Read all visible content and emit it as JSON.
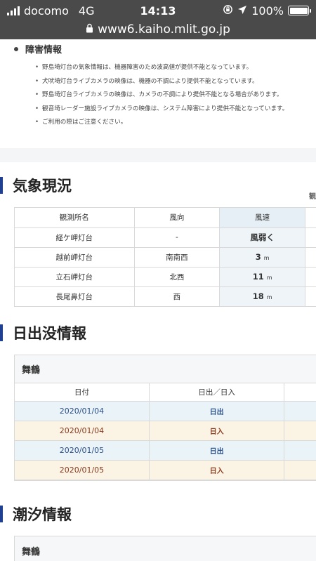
{
  "status_bar": {
    "carrier": "docomo",
    "network": "4G",
    "time": "14:13",
    "battery": "100%"
  },
  "url_bar": {
    "url": "www6.kaiho.mlit.go.jp"
  },
  "notice": {
    "title": "障害情報",
    "items": [
      "野島埼灯台の気象情報は、機器障害のため波高値が提供不能となっています。",
      "犬吠埼灯台ライブカメラの映像は、機器の不調により提供不能となっています。",
      "野島埼灯台ライブカメラの映像は、カメラの不調により提供不能となる場合があります。",
      "観音埼レーダー施設ライブカメラの映像は、システム障害により提供不能となっています。",
      "ご利用の際はご注意ください。"
    ]
  },
  "weather": {
    "title": "気象現況",
    "scroll_hint": "観",
    "headers": [
      "観測所名",
      "風向",
      "風速"
    ],
    "rows": [
      {
        "station": "経ケ岬灯台",
        "direction": "-",
        "speed": "風弱く",
        "unit": ""
      },
      {
        "station": "越前岬灯台",
        "direction": "南南西",
        "speed": "3",
        "unit": "m"
      },
      {
        "station": "立石岬灯台",
        "direction": "北西",
        "speed": "11",
        "unit": "m"
      },
      {
        "station": "長尾鼻灯台",
        "direction": "西",
        "speed": "18",
        "unit": "m"
      }
    ]
  },
  "sun": {
    "title": "日出没情報",
    "location": "舞鶴",
    "headers": [
      "日付",
      "日出／日入"
    ],
    "rows": [
      {
        "date": "2020/01/04",
        "kind": "日出"
      },
      {
        "date": "2020/01/04",
        "kind": "日入"
      },
      {
        "date": "2020/01/05",
        "kind": "日出"
      },
      {
        "date": "2020/01/05",
        "kind": "日入"
      }
    ]
  },
  "tide": {
    "title": "潮汐情報",
    "location": "舞鶴"
  }
}
